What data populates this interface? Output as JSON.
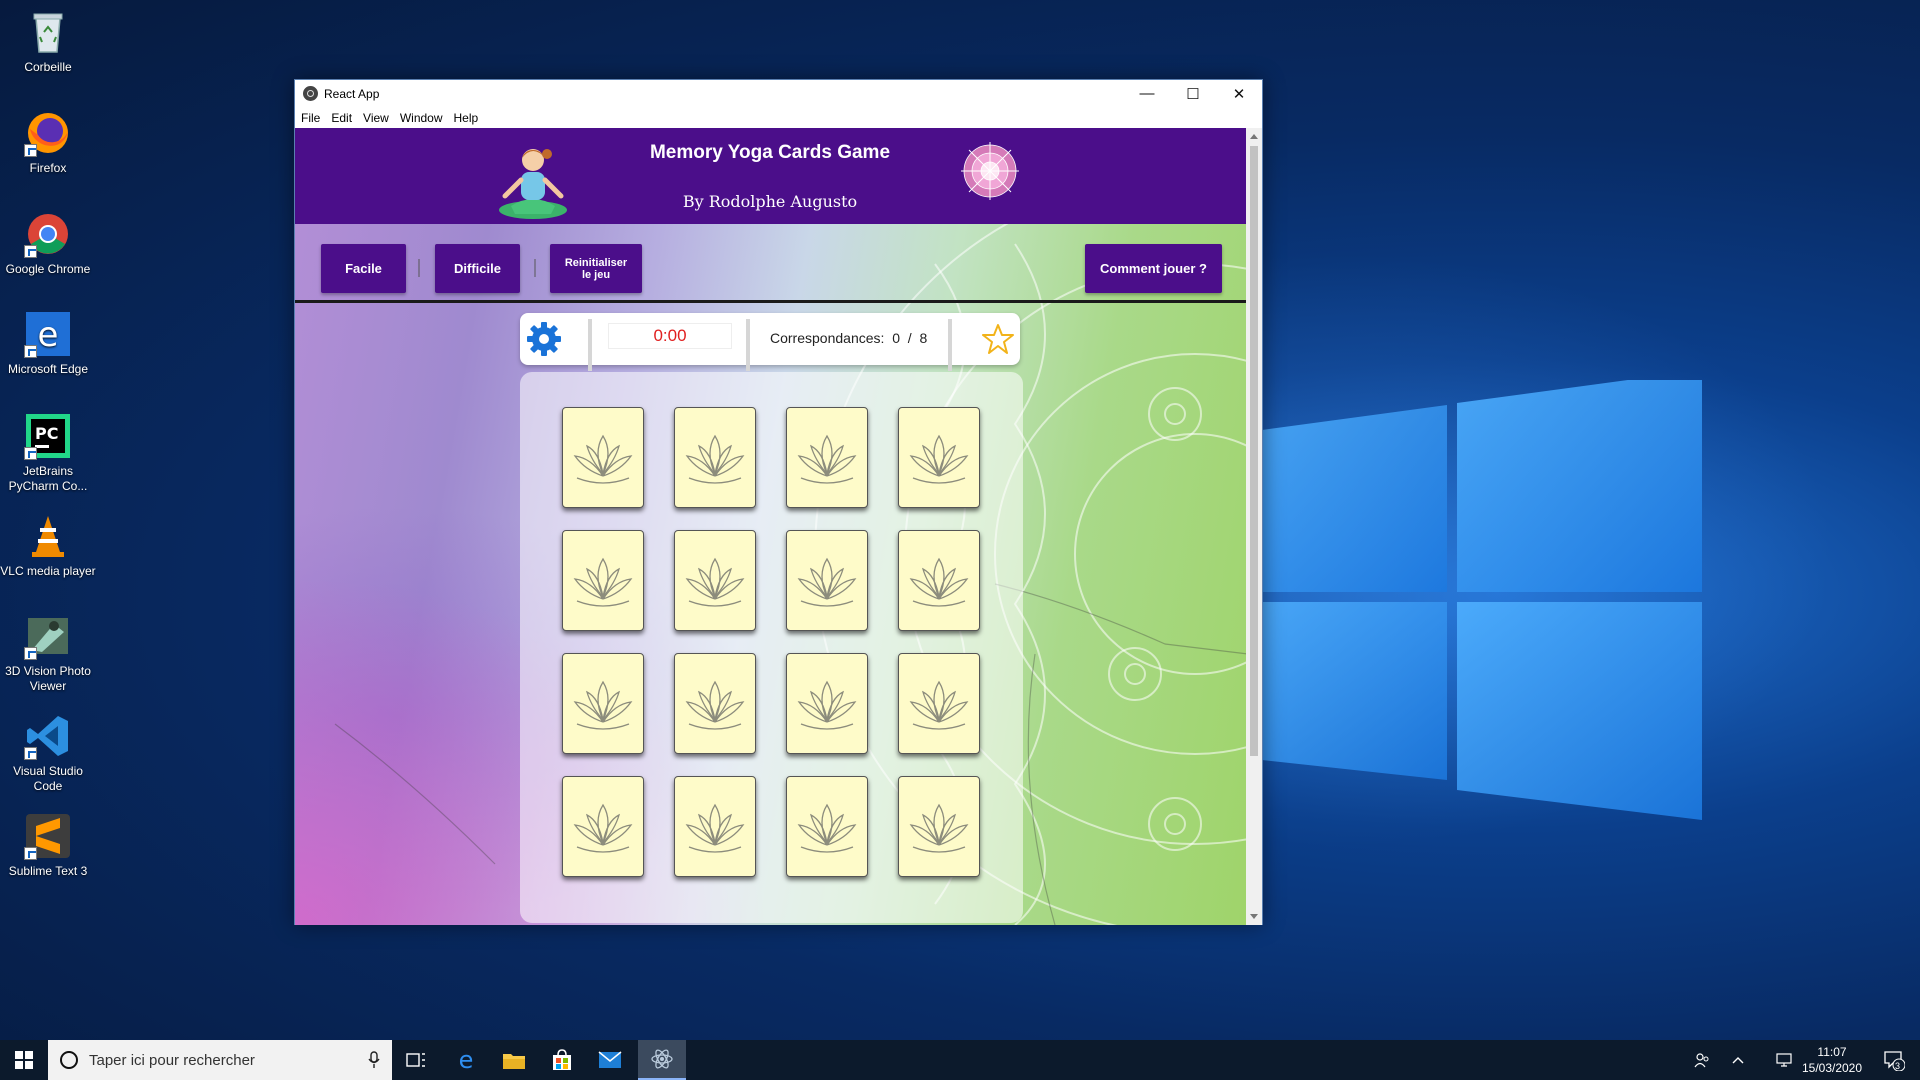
{
  "desktop": {
    "icons": [
      {
        "label": "Corbeille",
        "icon": "recycle-bin-icon"
      },
      {
        "label": "Firefox",
        "icon": "firefox-icon"
      },
      {
        "label": "Google Chrome",
        "icon": "chrome-icon"
      },
      {
        "label": "Microsoft Edge",
        "icon": "edge-icon"
      },
      {
        "label": "JetBrains PyCharm Co...",
        "icon": "pycharm-icon"
      },
      {
        "label": "VLC media player",
        "icon": "vlc-icon"
      },
      {
        "label": "3D Vision Photo Viewer",
        "icon": "3d-vision-icon"
      },
      {
        "label": "Visual Studio Code",
        "icon": "vscode-icon"
      },
      {
        "label": "Sublime Text 3",
        "icon": "sublime-icon"
      }
    ]
  },
  "window": {
    "title": "React App",
    "menu": [
      "File",
      "Edit",
      "View",
      "Window",
      "Help"
    ]
  },
  "app": {
    "title": "Memory Yoga Cards Game",
    "author": "By Rodolphe Augusto",
    "buttons": {
      "easy": "Facile",
      "hard": "Difficile",
      "reset_line1": "Reinitialiser",
      "reset_line2": "le jeu",
      "how_to": "Comment jouer ?"
    },
    "score": {
      "timer": "0:00",
      "matches_label": "Correspondances:",
      "matches_found": "0",
      "matches_sep": "/",
      "matches_total": "8"
    },
    "cards": {
      "count": 16,
      "state": "face-down",
      "back_icon": "lotus-icon"
    }
  },
  "taskbar": {
    "search_placeholder": "Taper ici pour rechercher",
    "time": "11:07",
    "date": "15/03/2020",
    "notification_count": "3"
  },
  "colors": {
    "brand_purple": "#4b0e8a",
    "timer_red": "#e02020",
    "card_back": "#fefbc9",
    "gear_blue": "#1a73d8"
  }
}
